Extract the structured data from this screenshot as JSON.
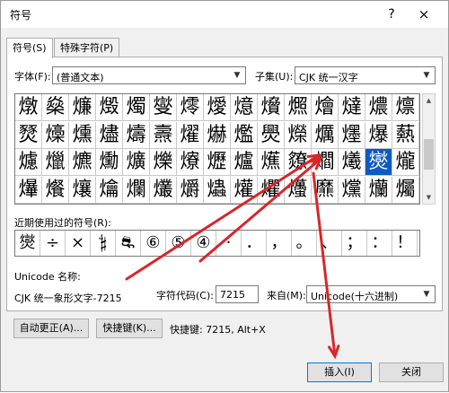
{
  "title": "符号",
  "help_label": "?",
  "close_label": "×",
  "tabs": [
    {
      "label": "符号(S)"
    },
    {
      "label": "特殊字符(P)"
    }
  ],
  "font": {
    "label": "字体(F):",
    "value": "(普通文本)"
  },
  "subset": {
    "label": "子集(U):",
    "value": "CJK 统一汉字"
  },
  "grid_rows": [
    [
      "燉",
      "燊",
      "燫",
      "燬",
      "燭",
      "燮",
      "燯",
      "燰",
      "燱",
      "燲",
      "燳",
      "燴",
      "燵",
      "燶",
      "燷"
    ],
    [
      "燹",
      "燺",
      "燻",
      "燼",
      "燽",
      "燾",
      "燿",
      "爀",
      "爁",
      "爂",
      "爃",
      "爄",
      "爅",
      "爆",
      "爇"
    ],
    [
      "爈",
      "爉",
      "爊",
      "爋",
      "爌",
      "爍",
      "爎",
      "爏",
      "爐",
      "爑",
      "爒",
      "爓",
      "爔",
      "爕",
      "爖"
    ],
    [
      "爗",
      "爘",
      "爙",
      "爚",
      "爛",
      "爜",
      "爝",
      "爞",
      "爟",
      "爠",
      "爡",
      "爢",
      "爣",
      "爤",
      "爥"
    ]
  ],
  "selected_char": "爕",
  "recent_label": "近期使用过的符号(R):",
  "recent": [
    "爕",
    "÷",
    "×",
    "𝄲",
    "⛐",
    "⑥",
    "⑤",
    "④",
    "·",
    "．",
    "，",
    "。",
    "、",
    "；",
    "：",
    "！"
  ],
  "unicode_name_label": "Unicode 名称:",
  "unicode_name": "CJK 统一象形文字-7215",
  "char_code_label": "字符代码(C):",
  "char_code": "7215",
  "from_label": "来自(M):",
  "from_value": "Unicode(十六进制)",
  "autocorrect_button": "自动更正(A)...",
  "shortcut_button": "快捷键(K)...",
  "shortcut_text": "快捷键: 7215, Alt+X",
  "insert_button": "插入(I)",
  "close_button": "关闭",
  "annotation_color": "#d9252b"
}
